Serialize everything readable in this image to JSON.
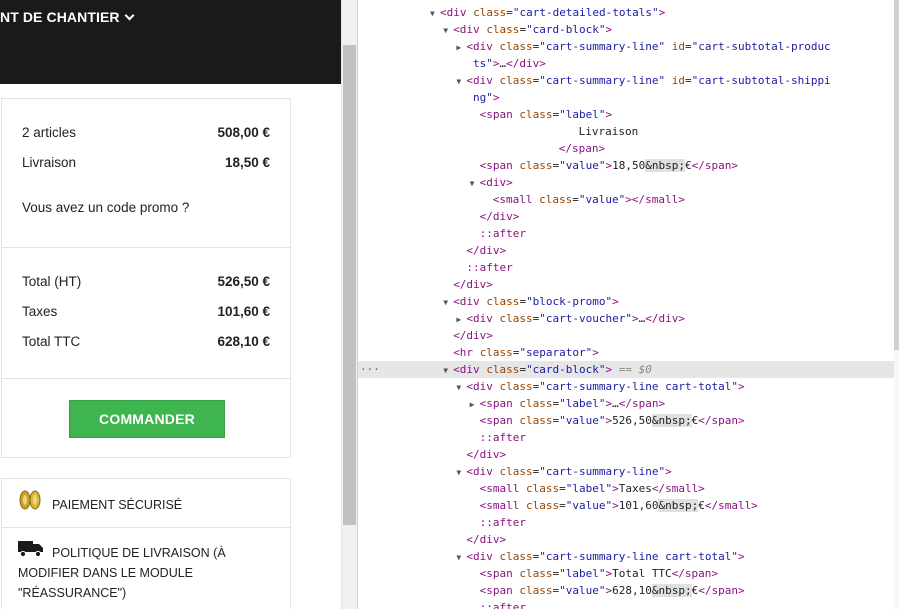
{
  "nav": {
    "label": "NT DE CHANTIER"
  },
  "cart": {
    "articles_label": "2 articles",
    "articles_value": "508,00 €",
    "shipping_label": "Livraison",
    "shipping_value": "18,50 €",
    "promo_prompt": "Vous avez un code promo ?",
    "total_ht_label": "Total (HT)",
    "total_ht_value": "526,50 €",
    "taxes_label": "Taxes",
    "taxes_value": "101,60 €",
    "total_ttc_label": "Total TTC",
    "total_ttc_value": "628,10 €",
    "order_button": "COMMANDER"
  },
  "reassurance": {
    "secure_payment": "PAIEMENT SÉCURISÉ",
    "delivery_line1": "POLITIQUE DE LIVRAISON (À",
    "delivery_line2": "MODIFIER DANS LE MODULE",
    "delivery_line3": "\"RÉASSURANCE\")"
  },
  "colors": {
    "accent_green": "#3eb54f",
    "nav_bg": "#1a1a1a"
  },
  "devtools": {
    "lines": [
      {
        "indent": 10,
        "tri": "down",
        "html": "<span class='tag'>&lt;div</span> <span class='an'>class</span>=<span class='av'>\"cart-detailed-totals\"</span><span class='tag'>&gt;</span>"
      },
      {
        "indent": 12,
        "tri": "down",
        "html": "<span class='tag'>&lt;div</span> <span class='an'>class</span>=<span class='av'>\"card-block\"</span><span class='tag'>&gt;</span>"
      },
      {
        "indent": 14,
        "tri": "right",
        "html": "<span class='tag'>&lt;div</span> <span class='an'>class</span>=<span class='av'>\"cart-summary-line\"</span> <span class='an'>id</span>=<span class='av'>\"cart-subtotal-produc</span>"
      },
      {
        "indent": 15,
        "tri": "",
        "html": "<span class='av'>ts\"</span><span class='tag'>&gt;</span>…<span class='tag'>&lt;/div&gt;</span>"
      },
      {
        "indent": 14,
        "tri": "down",
        "html": "<span class='tag'>&lt;div</span> <span class='an'>class</span>=<span class='av'>\"cart-summary-line\"</span> <span class='an'>id</span>=<span class='av'>\"cart-subtotal-shippi</span>"
      },
      {
        "indent": 15,
        "tri": "",
        "html": "<span class='av'>ng\"</span><span class='tag'>&gt;</span>"
      },
      {
        "indent": 16,
        "tri": "",
        "html": "<span class='tag'>&lt;span</span> <span class='an'>class</span>=<span class='av'>\"label\"</span><span class='tag'>&gt;</span>"
      },
      {
        "indent": 31,
        "tri": "",
        "html": "<span class='tx'>Livraison</span>"
      },
      {
        "indent": 28,
        "tri": "",
        "html": "<span class='tag'>&lt;/span&gt;</span>"
      },
      {
        "indent": 16,
        "tri": "",
        "html": "<span class='tag'>&lt;span</span> <span class='an'>class</span>=<span class='av'>\"value\"</span><span class='tag'>&gt;</span><span class='tx'>18,50</span><span class='ent'>&amp;nbsp;</span><span class='tx'>€</span><span class='tag'>&lt;/span&gt;</span>"
      },
      {
        "indent": 16,
        "tri": "down",
        "html": "<span class='tag'>&lt;div&gt;</span>"
      },
      {
        "indent": 18,
        "tri": "",
        "html": "<span class='tag'>&lt;small</span> <span class='an'>class</span>=<span class='av'>\"value\"</span><span class='tag'>&gt;&lt;/small&gt;</span>"
      },
      {
        "indent": 16,
        "tri": "",
        "html": "<span class='tag'>&lt;/div&gt;</span>"
      },
      {
        "indent": 16,
        "tri": "",
        "html": "<span class='pseudo'>::after</span>"
      },
      {
        "indent": 14,
        "tri": "",
        "html": "<span class='tag'>&lt;/div&gt;</span>"
      },
      {
        "indent": 14,
        "tri": "",
        "html": "<span class='pseudo'>::after</span>"
      },
      {
        "indent": 12,
        "tri": "",
        "html": "<span class='tag'>&lt;/div&gt;</span>"
      },
      {
        "indent": 12,
        "tri": "down",
        "html": "<span class='tag'>&lt;div</span> <span class='an'>class</span>=<span class='av'>\"block-promo\"</span><span class='tag'>&gt;</span>"
      },
      {
        "indent": 14,
        "tri": "right",
        "html": "<span class='tag'>&lt;div</span> <span class='an'>class</span>=<span class='av'>\"cart-voucher\"</span><span class='tag'>&gt;</span>…<span class='tag'>&lt;/div&gt;</span>"
      },
      {
        "indent": 12,
        "tri": "",
        "html": "<span class='tag'>&lt;/div&gt;</span>"
      },
      {
        "indent": 12,
        "tri": "",
        "html": "<span class='tag'>&lt;hr</span> <span class='an'>class</span>=<span class='av'>\"separator\"</span><span class='tag'>&gt;</span>"
      },
      {
        "indent": 12,
        "tri": "down",
        "sel": true,
        "html": "<span class='tag'>&lt;div</span> <span class='an'>class</span>=<span class='av'>\"card-block\"</span><span class='tag'>&gt;</span> <span class='dim'>== $0</span>"
      },
      {
        "indent": 14,
        "tri": "down",
        "html": "<span class='tag'>&lt;div</span> <span class='an'>class</span>=<span class='av'>\"cart-summary-line cart-total\"</span><span class='tag'>&gt;</span>"
      },
      {
        "indent": 16,
        "tri": "right",
        "html": "<span class='tag'>&lt;span</span> <span class='an'>class</span>=<span class='av'>\"label\"</span><span class='tag'>&gt;</span>…<span class='tag'>&lt;/span&gt;</span>"
      },
      {
        "indent": 16,
        "tri": "",
        "html": "<span class='tag'>&lt;span</span> <span class='an'>class</span>=<span class='av'>\"value\"</span><span class='tag'>&gt;</span><span class='tx'>526,50</span><span class='ent'>&amp;nbsp;</span><span class='tx'>€</span><span class='tag'>&lt;/span&gt;</span>"
      },
      {
        "indent": 16,
        "tri": "",
        "html": "<span class='pseudo'>::after</span>"
      },
      {
        "indent": 14,
        "tri": "",
        "html": "<span class='tag'>&lt;/div&gt;</span>"
      },
      {
        "indent": 14,
        "tri": "down",
        "html": "<span class='tag'>&lt;div</span> <span class='an'>class</span>=<span class='av'>\"cart-summary-line\"</span><span class='tag'>&gt;</span>"
      },
      {
        "indent": 16,
        "tri": "",
        "html": "<span class='tag'>&lt;small</span> <span class='an'>class</span>=<span class='av'>\"label\"</span><span class='tag'>&gt;</span><span class='tx'>Taxes</span><span class='tag'>&lt;/small&gt;</span>"
      },
      {
        "indent": 16,
        "tri": "",
        "html": "<span class='tag'>&lt;small</span> <span class='an'>class</span>=<span class='av'>\"value\"</span><span class='tag'>&gt;</span><span class='tx'>101,60</span><span class='ent'>&amp;nbsp;</span><span class='tx'>€</span><span class='tag'>&lt;/small&gt;</span>"
      },
      {
        "indent": 16,
        "tri": "",
        "html": "<span class='pseudo'>::after</span>"
      },
      {
        "indent": 14,
        "tri": "",
        "html": "<span class='tag'>&lt;/div&gt;</span>"
      },
      {
        "indent": 14,
        "tri": "down",
        "html": "<span class='tag'>&lt;div</span> <span class='an'>class</span>=<span class='av'>\"cart-summary-line cart-total\"</span><span class='tag'>&gt;</span>"
      },
      {
        "indent": 16,
        "tri": "",
        "html": "<span class='tag'>&lt;span</span> <span class='an'>class</span>=<span class='av'>\"label\"</span><span class='tag'>&gt;</span><span class='tx'>Total TTC</span><span class='tag'>&lt;/span&gt;</span>"
      },
      {
        "indent": 16,
        "tri": "",
        "html": "<span class='tag'>&lt;span</span> <span class='an'>class</span>=<span class='av'>\"value\"</span><span class='tag'>&gt;</span><span class='tx'>628,10</span><span class='ent'>&amp;nbsp;</span><span class='tx'>€</span><span class='tag'>&lt;/span&gt;</span>"
      },
      {
        "indent": 16,
        "tri": "",
        "html": "<span class='pseudo'>::after</span>"
      }
    ]
  }
}
